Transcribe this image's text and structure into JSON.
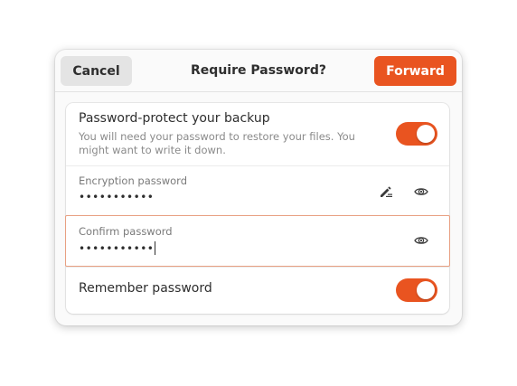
{
  "dialog": {
    "title": "Require Password?",
    "cancel_label": "Cancel",
    "forward_label": "Forward"
  },
  "protect": {
    "title": "Password-protect your backup",
    "subtitle": "You will need your password to restore your files. You might want to write it down.",
    "enabled": true
  },
  "encryption": {
    "label": "Encryption password",
    "value": "•••••••••••"
  },
  "confirm": {
    "label": "Confirm password",
    "value": "•••••••••••"
  },
  "remember": {
    "label": "Remember password",
    "enabled": true
  },
  "icons": {
    "generate": "edit-generate-icon",
    "reveal": "eye-icon"
  },
  "colors": {
    "accent": "#e95420",
    "focus": "#e8a082"
  }
}
